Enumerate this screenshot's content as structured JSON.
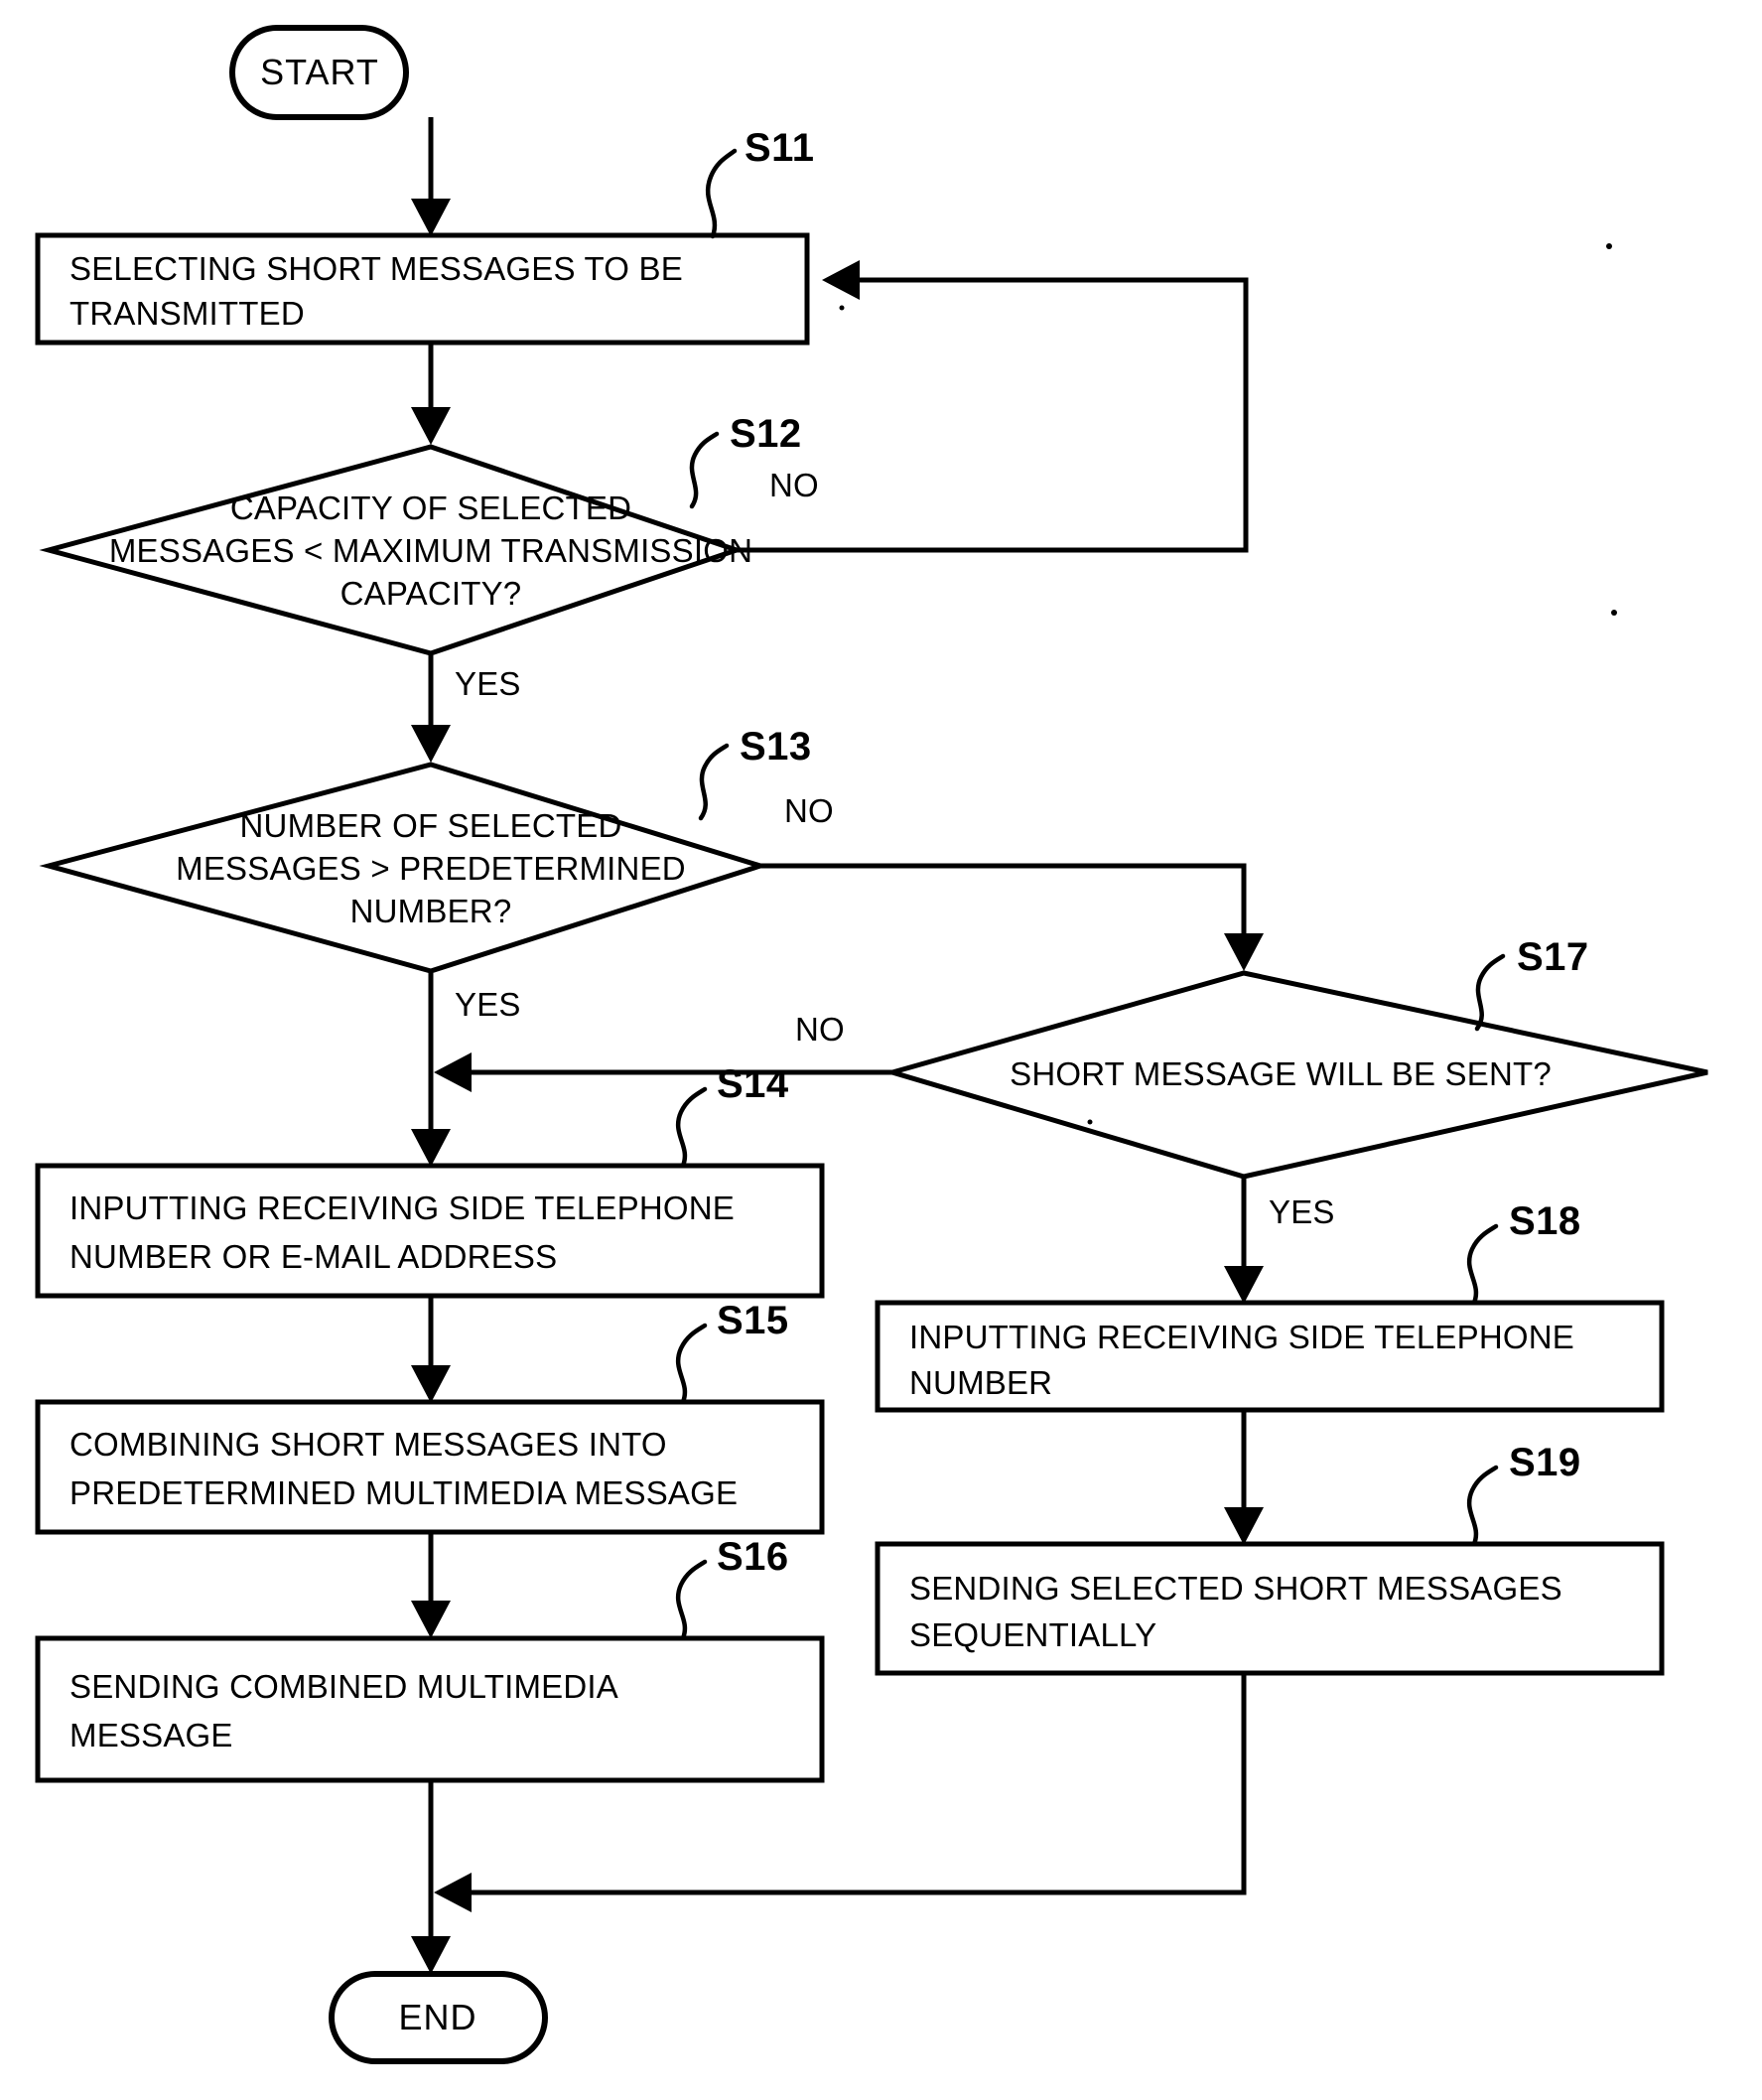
{
  "figure": {
    "type": "flowchart",
    "orientation": "vertical-two-column",
    "background_color": "#ffffff",
    "line_color": "#000000"
  },
  "nodes": {
    "start": {
      "shape": "terminator",
      "label": "START"
    },
    "end": {
      "shape": "terminator",
      "label": "END"
    },
    "s11": {
      "shape": "process",
      "step": "S11",
      "line1": "SELECTING SHORT MESSAGES TO BE",
      "line2": "TRANSMITTED"
    },
    "s12": {
      "shape": "decision",
      "step": "S12",
      "line1": "CAPACITY OF SELECTED",
      "line2": "MESSAGES < MAXIMUM TRANSMISSION",
      "line3": "CAPACITY?"
    },
    "s13": {
      "shape": "decision",
      "step": "S13",
      "line1": "NUMBER OF SELECTED",
      "line2": "MESSAGES > PREDETERMINED",
      "line3": "NUMBER?"
    },
    "s14": {
      "shape": "process",
      "step": "S14",
      "line1": "INPUTTING RECEIVING SIDE TELEPHONE",
      "line2": "NUMBER OR E-MAIL ADDRESS"
    },
    "s15": {
      "shape": "process",
      "step": "S15",
      "line1": "COMBINING SHORT MESSAGES INTO",
      "line2": "PREDETERMINED MULTIMEDIA MESSAGE"
    },
    "s16": {
      "shape": "process",
      "step": "S16",
      "line1": "SENDING COMBINED MULTIMEDIA",
      "line2": "MESSAGE"
    },
    "s17": {
      "shape": "decision",
      "step": "S17",
      "line1": "SHORT MESSAGE WILL BE SENT?"
    },
    "s18": {
      "shape": "process",
      "step": "S18",
      "line1": "INPUTTING RECEIVING SIDE TELEPHONE",
      "line2": "NUMBER"
    },
    "s19": {
      "shape": "process",
      "step": "S19",
      "line1": "SENDING SELECTED SHORT MESSAGES",
      "line2": "SEQUENTIALLY"
    }
  },
  "branch_labels": {
    "s12_no": "NO",
    "s12_yes": "YES",
    "s13_no": "NO",
    "s13_yes": "YES",
    "s17_no": "NO",
    "s17_yes": "YES"
  },
  "edges": [
    {
      "from": "start",
      "to": "s11",
      "label": ""
    },
    {
      "from": "s11",
      "to": "s12",
      "label": ""
    },
    {
      "from": "s12",
      "to": "s11",
      "label": "NO"
    },
    {
      "from": "s12",
      "to": "s13",
      "label": "YES"
    },
    {
      "from": "s13",
      "to": "s17",
      "label": "NO"
    },
    {
      "from": "s13",
      "to": "s14",
      "label": "YES"
    },
    {
      "from": "s14",
      "to": "s15",
      "label": ""
    },
    {
      "from": "s15",
      "to": "s16",
      "label": ""
    },
    {
      "from": "s16",
      "to": "end",
      "label": ""
    },
    {
      "from": "s17",
      "to": "s14",
      "label": "NO"
    },
    {
      "from": "s17",
      "to": "s18",
      "label": "YES"
    },
    {
      "from": "s18",
      "to": "s19",
      "label": ""
    },
    {
      "from": "s19",
      "to": "end",
      "label": ""
    }
  ]
}
